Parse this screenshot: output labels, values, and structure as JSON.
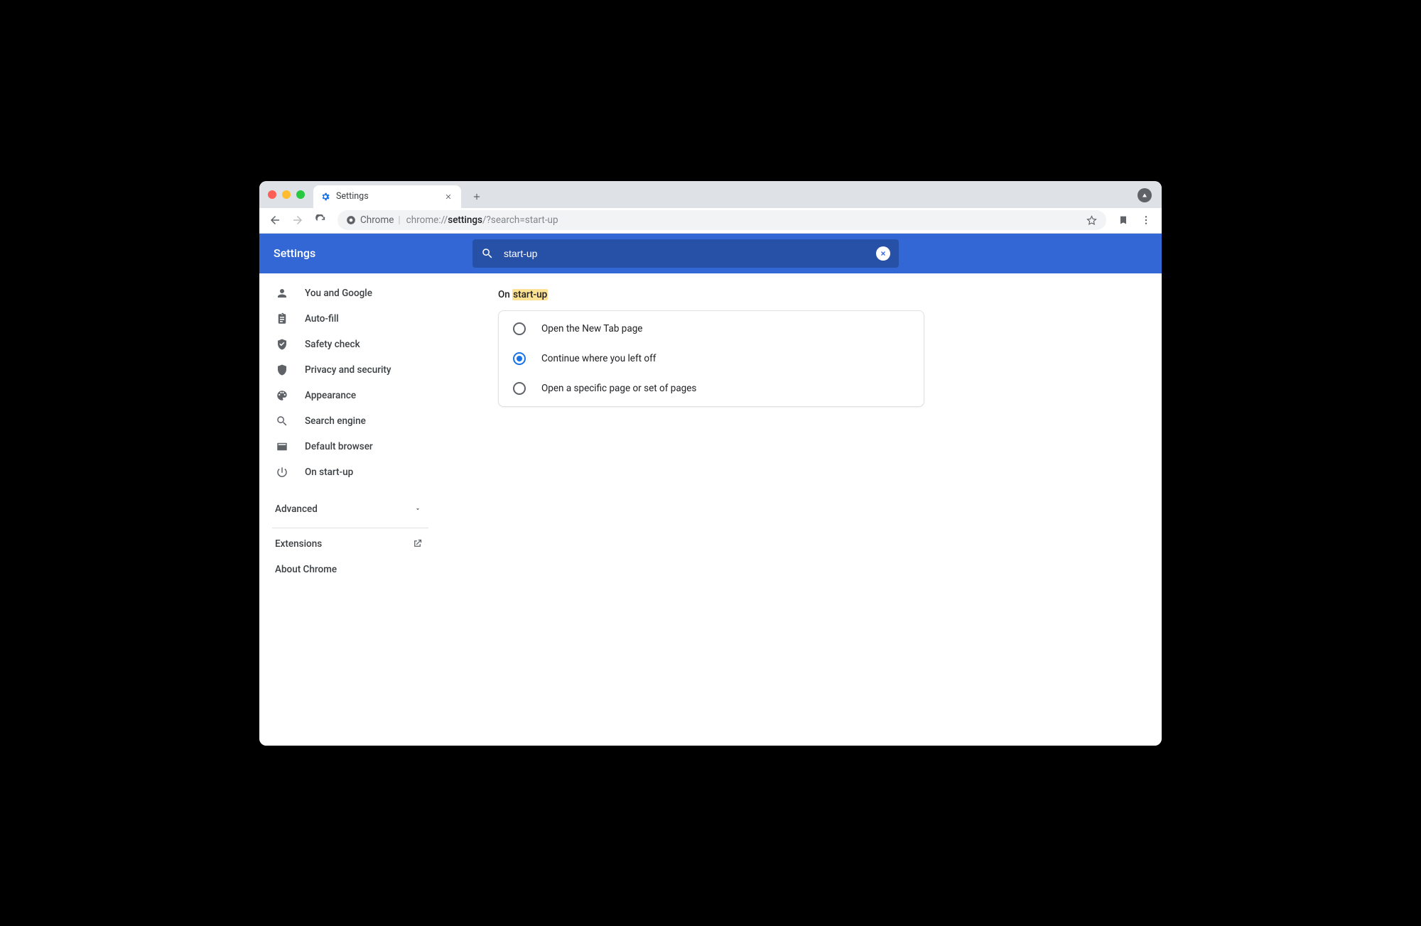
{
  "browser": {
    "tab_title": "Settings",
    "url_host": "Chrome",
    "url_prefix": "chrome://",
    "url_bold": "settings",
    "url_suffix": "/?search=start-up"
  },
  "header": {
    "title": "Settings",
    "search_value": "start-up"
  },
  "sidebar": {
    "items": [
      {
        "id": "you-and-google",
        "label": "You and Google"
      },
      {
        "id": "auto-fill",
        "label": "Auto-fill"
      },
      {
        "id": "safety-check",
        "label": "Safety check"
      },
      {
        "id": "privacy-security",
        "label": "Privacy and security"
      },
      {
        "id": "appearance",
        "label": "Appearance"
      },
      {
        "id": "search-engine",
        "label": "Search engine"
      },
      {
        "id": "default-browser",
        "label": "Default browser"
      },
      {
        "id": "on-start-up",
        "label": "On start-up"
      }
    ],
    "advanced_label": "Advanced",
    "extensions_label": "Extensions",
    "about_label": "About Chrome"
  },
  "main": {
    "heading_prefix": "On ",
    "heading_highlight": "start-up",
    "options": [
      {
        "label": "Open the New Tab page",
        "selected": false
      },
      {
        "label": "Continue where you left off",
        "selected": true
      },
      {
        "label": "Open a specific page or set of pages",
        "selected": false
      }
    ]
  }
}
